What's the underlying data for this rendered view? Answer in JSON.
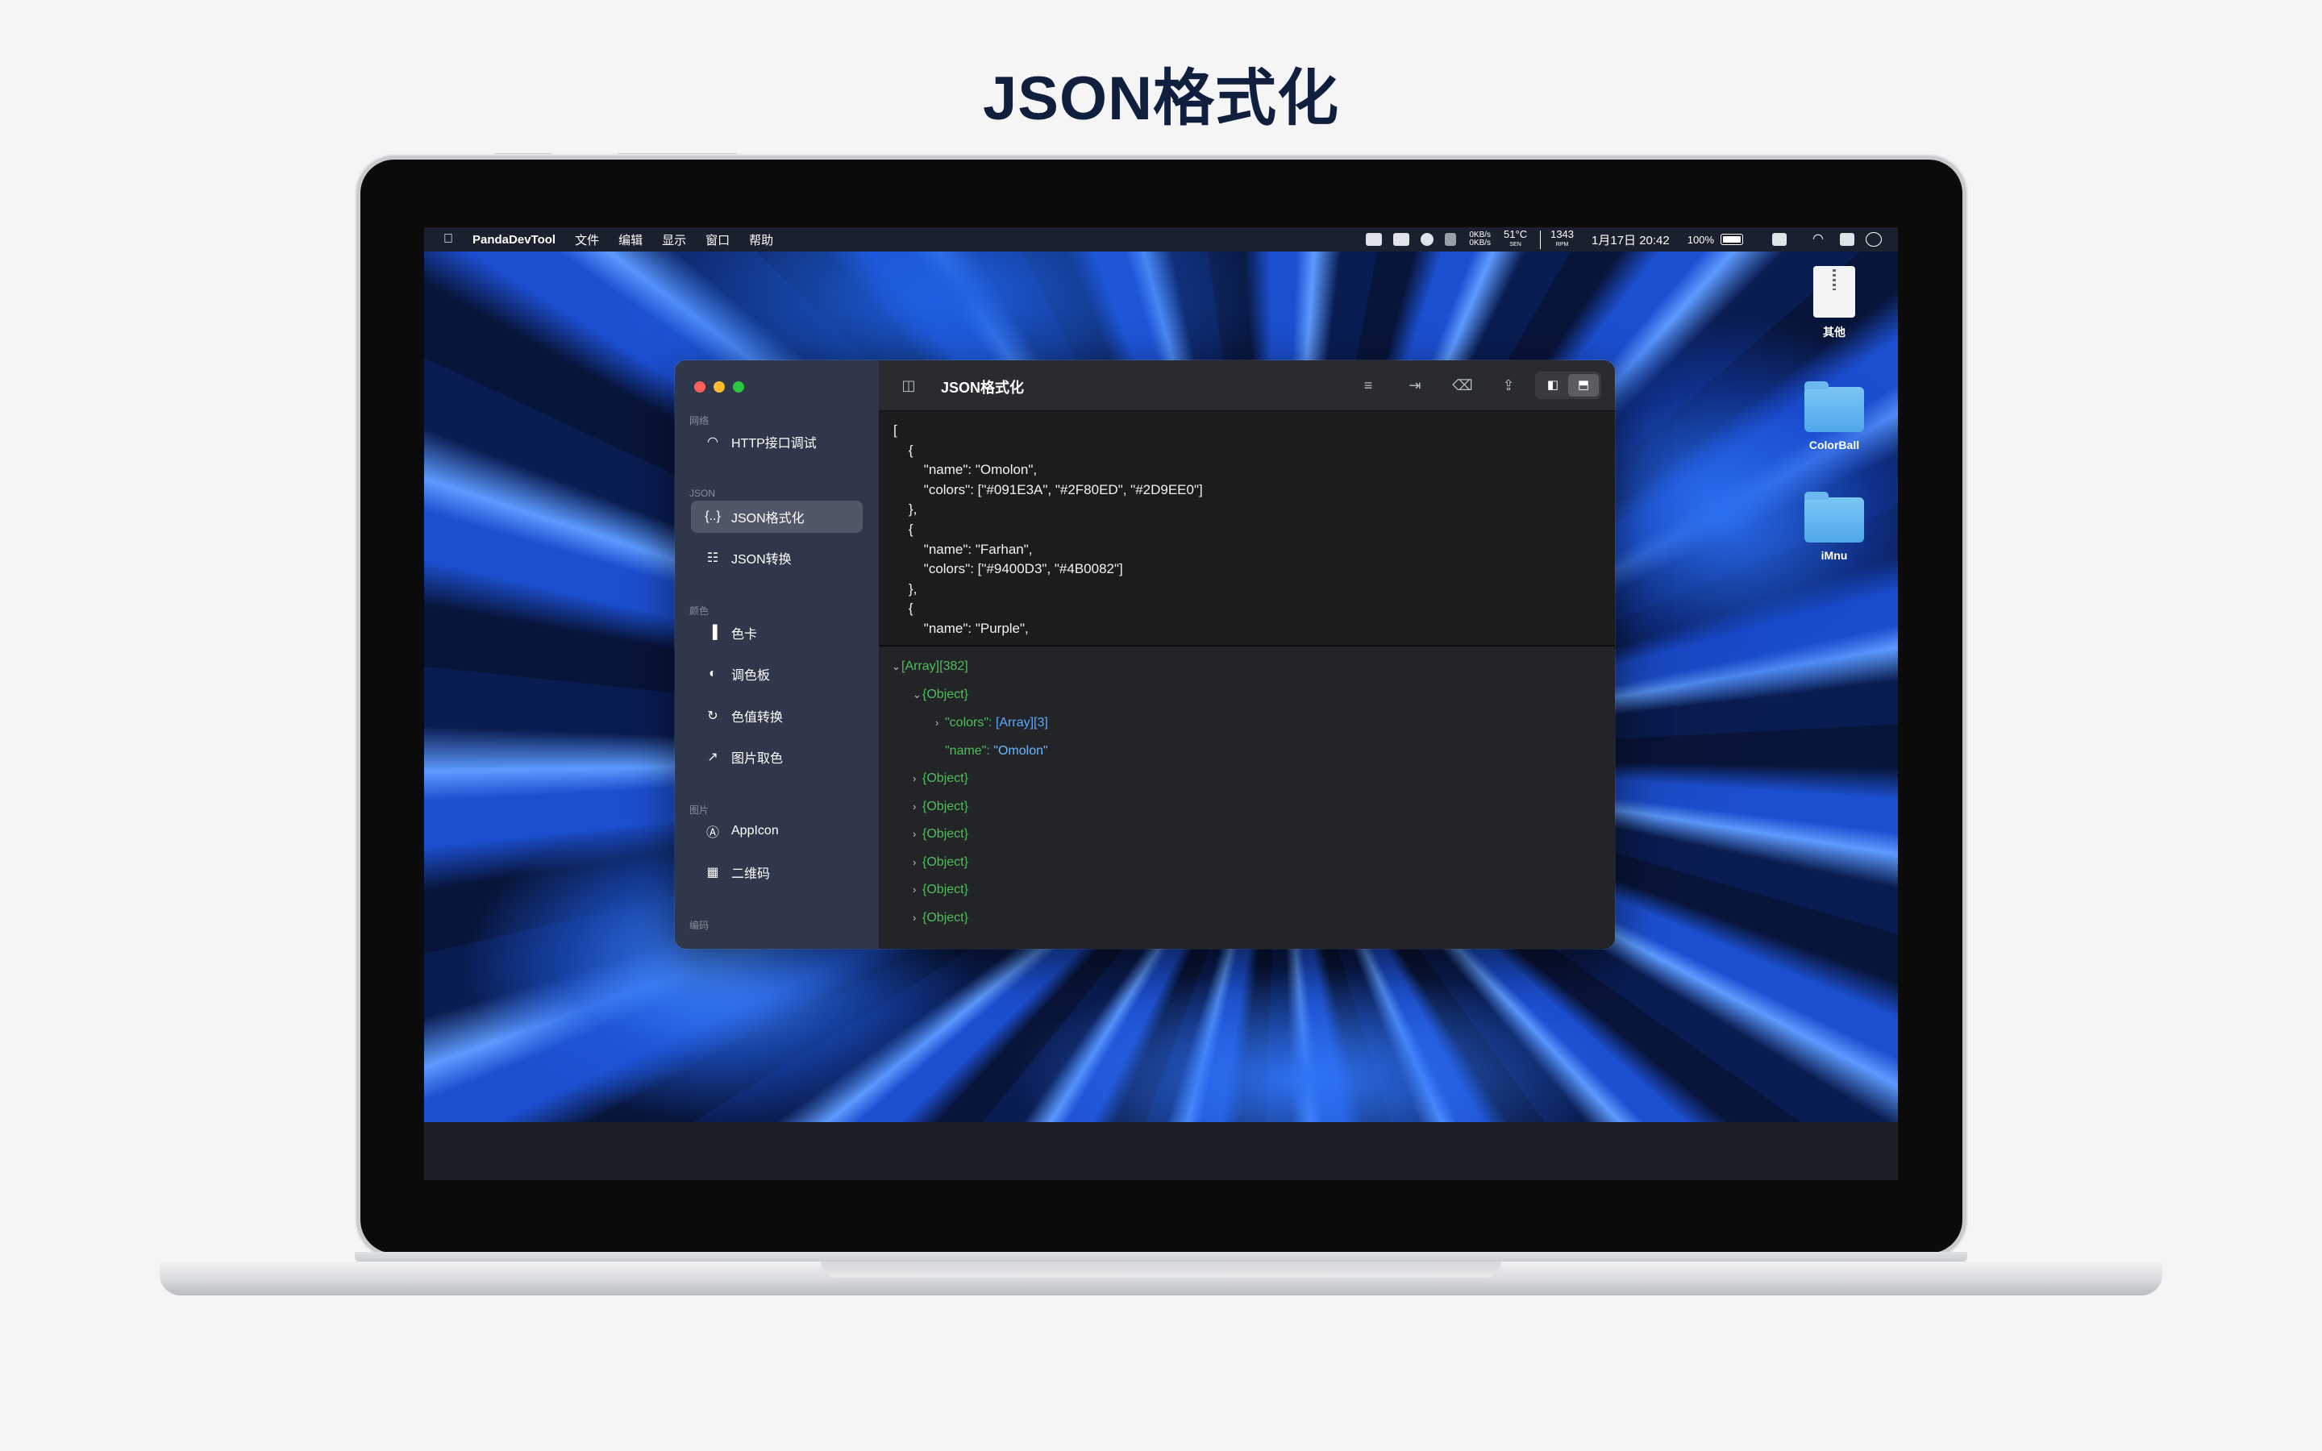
{
  "page": {
    "headline": "JSON格式化"
  },
  "menubar": {
    "app_name": "PandaDevTool",
    "menus": [
      "文件",
      "编辑",
      "显示",
      "窗口",
      "帮助"
    ],
    "net_up": "0KB/s",
    "net_down": "0KB/s",
    "cpu_temp": "51°C",
    "cpu_temp_sub": "SEN",
    "fan_speed": "1343",
    "fan_speed_sub": "RPM",
    "clock": "1月17日 20:42",
    "battery": "100%"
  },
  "desktop": {
    "items": [
      {
        "label": "其他"
      },
      {
        "label": "ColorBall"
      },
      {
        "label": "iMnu"
      }
    ]
  },
  "sidebar": {
    "sections": [
      "网络",
      "JSON",
      "颜色",
      "图片",
      "编码"
    ],
    "items": [
      {
        "label": "HTTP接口调试",
        "icon": "wifi-icon"
      },
      {
        "label": "JSON格式化",
        "icon": "curly-braces-icon"
      },
      {
        "label": "JSON转换",
        "icon": "convert-icon"
      },
      {
        "label": "色卡",
        "icon": "swatch-icon"
      },
      {
        "label": "调色板",
        "icon": "palette-icon"
      },
      {
        "label": "色值转换",
        "icon": "color-convert-icon"
      },
      {
        "label": "图片取色",
        "icon": "eyedropper-icon"
      },
      {
        "label": "AppIcon",
        "icon": "app-store-icon"
      },
      {
        "label": "二维码",
        "icon": "qrcode-icon"
      }
    ]
  },
  "toolbar": {
    "title": "JSON格式化"
  },
  "editor": {
    "lines": [
      "[",
      "    {",
      "        \"name\": \"Omolon\",",
      "        \"colors\": [\"#091E3A\", \"#2F80ED\", \"#2D9EE0\"]",
      "    },",
      "    {",
      "        \"name\": \"Farhan\",",
      "        \"colors\": [\"#9400D3\", \"#4B0082\"]",
      "    },",
      "    {",
      "        \"name\": \"Purple\","
    ]
  },
  "tree": {
    "root": "[Array][382]",
    "first_object": "{Object}",
    "colors_key": "\"colors\":",
    "colors_value": "[Array][3]",
    "name_key": "\"name\":",
    "name_value": "\"Omolon\"",
    "collapsed_objects": [
      "{Object}",
      "{Object}",
      "{Object}",
      "{Object}",
      "{Object}",
      "{Object}"
    ]
  }
}
